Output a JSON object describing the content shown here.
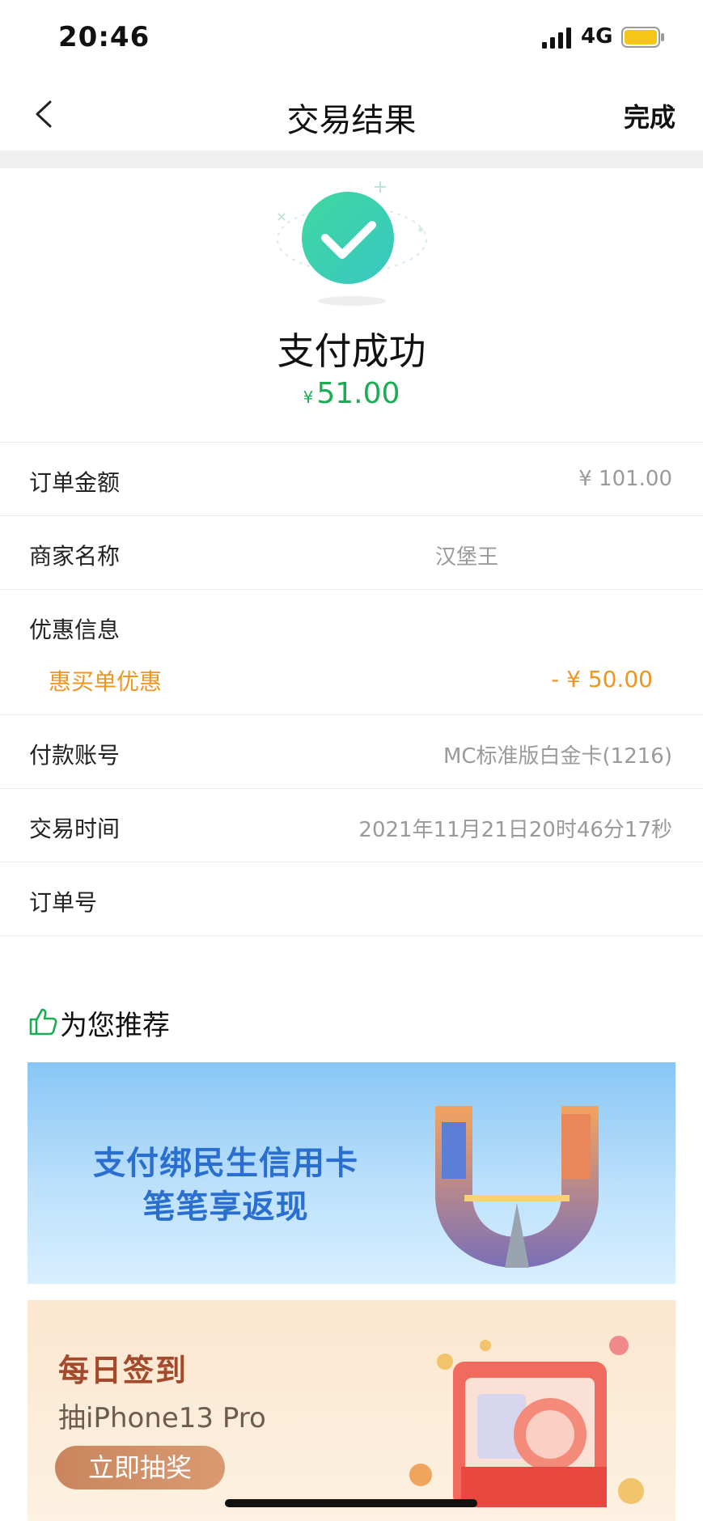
{
  "status_bar": {
    "time": "20:46",
    "network": "4G"
  },
  "nav": {
    "title": "交易结果",
    "done_label": "完成"
  },
  "result": {
    "title": "支付成功",
    "currency_symbol": "¥",
    "amount": "51.00"
  },
  "details": {
    "order_amount": {
      "label": "订单金额",
      "value": "¥ 101.00"
    },
    "merchant": {
      "label": "商家名称",
      "value": "汉堡王"
    },
    "discount": {
      "label": "优惠信息",
      "item_label": "惠买单优惠",
      "item_value": "- ¥ 50.00"
    },
    "account": {
      "label": "付款账号",
      "value": "MC标准版白金卡(1216)"
    },
    "time": {
      "label": "交易时间",
      "value": "2021年11月21日20时46分17秒"
    },
    "order_no": {
      "label": "订单号",
      "value": ""
    }
  },
  "recommend": {
    "title": "为您推荐",
    "banner1": {
      "line1": "支付绑民生信用卡",
      "line2": "笔笔享返现"
    },
    "banner2": {
      "title": "每日签到",
      "subtitle": "抽iPhone13 Pro",
      "button_label": "立即抽奖"
    }
  },
  "colors": {
    "success_green": "#1aad54",
    "discount_orange": "#f0951f",
    "banner_blue_text": "#2a6fd0",
    "battery_yellow": "#f5c518"
  }
}
